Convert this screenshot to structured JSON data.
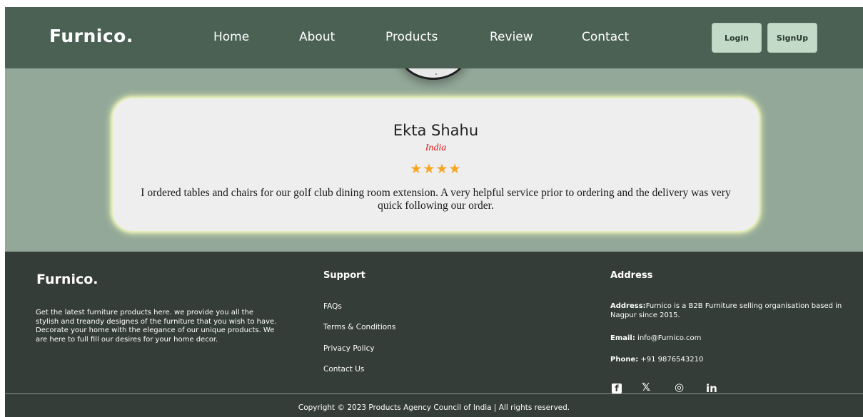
{
  "nav": {
    "brand": "Furnico.",
    "links": [
      "Home",
      "About",
      "Products",
      "Review",
      "Contact"
    ],
    "login_label": "Login",
    "signup_label": "SignUp"
  },
  "review": {
    "name": "Ekta Shahu",
    "country": "India",
    "rating": 4,
    "stars": "★★★★",
    "text": "I ordered tables and chairs for our golf club dining room extension. A very helpful service prior to ordering and the delivery was very quick following our order."
  },
  "footer": {
    "brand": "Furnico.",
    "about": "Get the latest furniture products here. we provide you all the stylish and treandy designes of the furniture that you wish to have. Decorate your home with the elegance of our unique products. We are here to full fill our desires for your home decor.",
    "support_heading": "Support",
    "support_links": [
      "FAQs",
      "Terms & Conditions",
      "Privacy Policy",
      "Contact Us"
    ],
    "address_heading": "Address",
    "address_label": "Address:",
    "address_value": "Furnico is a B2B Furniture selling organisation based in Nagpur since 2015.",
    "email_label": "Email:",
    "email_value": " info@Furnico.com",
    "phone_label": "Phone:",
    "phone_value": " +91 9876543210",
    "socials": {
      "facebook": "f",
      "x": "𝕏",
      "instagram": "◎",
      "linkedin": "in"
    },
    "copyright": "Copyright © 2023 Products Agency Council of India | All rights reserved."
  },
  "colors": {
    "nav_bg": "#4a6154",
    "page_bg": "#93a898",
    "footer_bg": "#353d38",
    "button_bg": "#c4dac8",
    "star": "#f6a623",
    "country": "#e01b1b"
  }
}
